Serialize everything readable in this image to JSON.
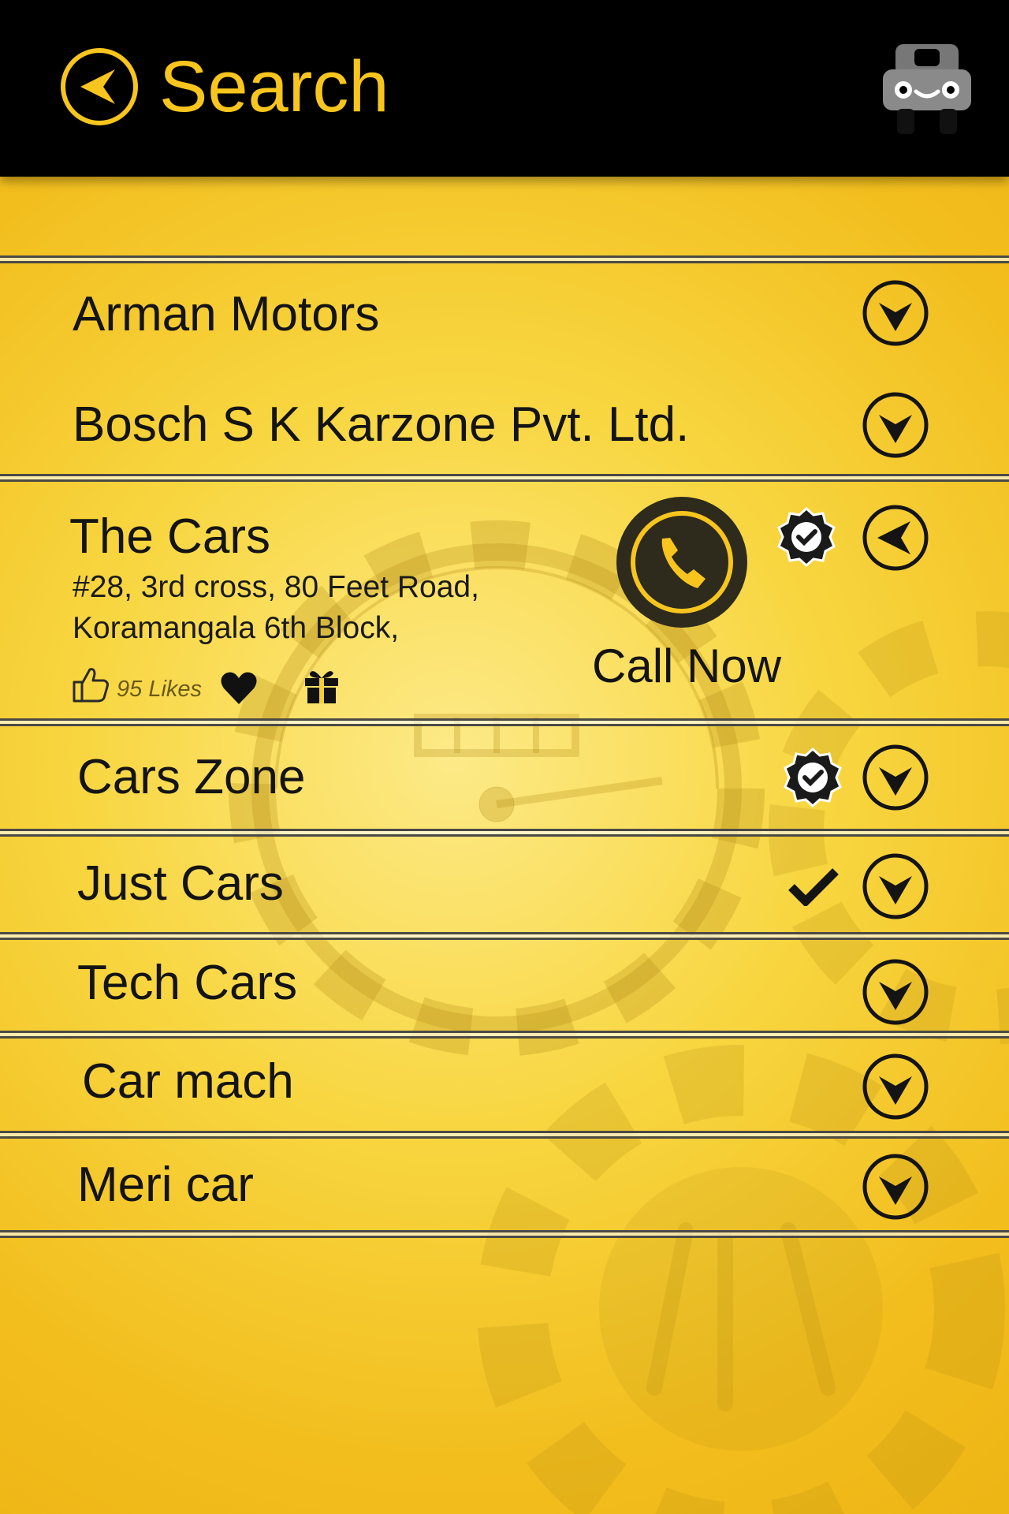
{
  "header": {
    "title": "Search",
    "back_icon": "back-arrow-circle-icon",
    "logo_icon": "robot-car-logo-icon"
  },
  "colors": {
    "accent": "#f7c51e",
    "header_bg": "#000000",
    "text": "#141414"
  },
  "results": [
    {
      "name": "Arman Motors",
      "action_icon": "chevron-down-icon"
    },
    {
      "name": "Bosch S K Karzone Pvt. Ltd.",
      "action_icon": "chevron-down-icon"
    },
    {
      "name": "The Cars",
      "address_line1": "#28, 3rd cross, 80 Feet Road,",
      "address_line2": "Koramangala 6th Block,",
      "likes": "95 Likes",
      "call_label": "Call Now",
      "verified": true,
      "action_icon": "chevron-left-icon"
    },
    {
      "name": "Cars Zone",
      "verified": true,
      "action_icon": "chevron-down-icon"
    },
    {
      "name": "Just Cars",
      "checked": true,
      "action_icon": "chevron-down-icon"
    },
    {
      "name": "Tech Cars",
      "action_icon": "chevron-down-icon"
    },
    {
      "name": "Car mach",
      "action_icon": "chevron-down-icon"
    },
    {
      "name": "Meri car",
      "action_icon": "chevron-down-icon"
    }
  ]
}
